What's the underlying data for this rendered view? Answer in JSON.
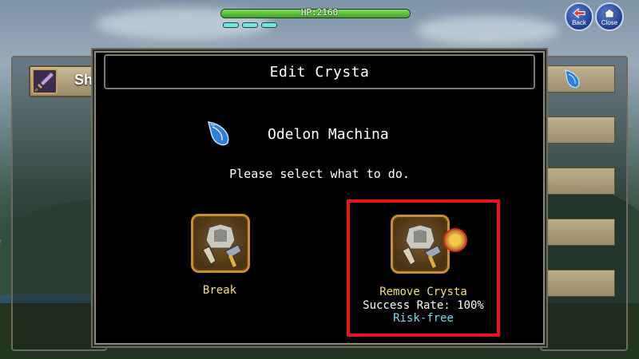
{
  "hud": {
    "hp_label": "HP:2160",
    "hp_fraction": 1.0,
    "mp_pips": 3
  },
  "top_buttons": {
    "back_label": "Back",
    "close_label": "Close"
  },
  "background_tab": {
    "label": "Sh"
  },
  "dialog": {
    "title": "Edit Crysta",
    "crysta_name": "Odelon Machina",
    "instruction": "Please select what to do.",
    "options": {
      "break": {
        "label": "Break"
      },
      "remove": {
        "label": "Remove Crysta",
        "success_rate": "Success Rate: 100%",
        "risk": "Risk-free"
      }
    }
  },
  "colors": {
    "highlight_border": "#e8141c",
    "option_label": "#f4e06a",
    "risk_text": "#6ee0f0",
    "hp_bar": "#5cc23e"
  }
}
